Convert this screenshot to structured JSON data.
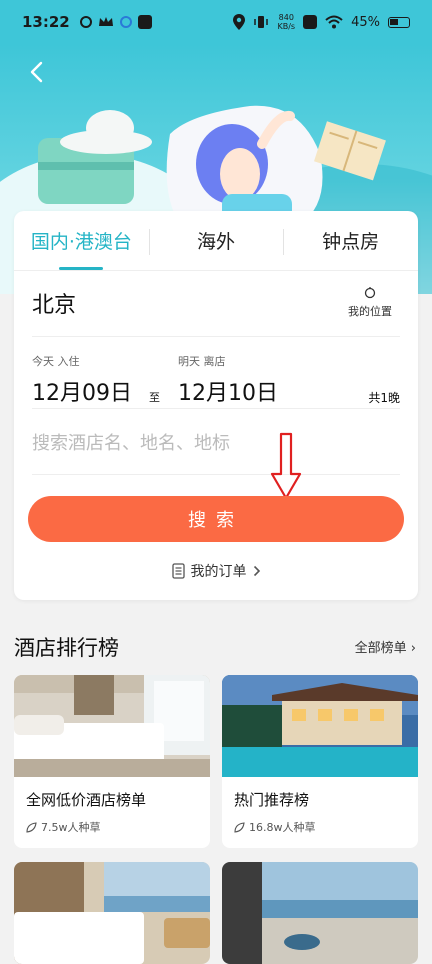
{
  "status_bar": {
    "time": "13:22",
    "net_speed_value": "840",
    "net_speed_unit": "KB/s",
    "battery": "45%"
  },
  "tabs": [
    {
      "label": "国内·港澳台",
      "active": true
    },
    {
      "label": "海外",
      "active": false
    },
    {
      "label": "钟点房",
      "active": false
    }
  ],
  "search_form": {
    "city": "北京",
    "my_location": "我的位置",
    "checkin_label": "今天  入住",
    "checkin_date": "12月09日",
    "separator": "至",
    "checkout_label": "明天  离店",
    "checkout_date": "12月10日",
    "nights": "共1晚",
    "keyword_placeholder": "搜索酒店名、地名、地标",
    "search_button": "搜索",
    "my_orders": "我的订单"
  },
  "ranking": {
    "title": "酒店排行榜",
    "all_lists": "全部榜单",
    "items": [
      {
        "name": "全网低价酒店榜单",
        "meta": "7.5w人种草"
      },
      {
        "name": "热门推荐榜",
        "meta": "16.8w人种草"
      }
    ]
  },
  "colors": {
    "accent": "#25b4c6",
    "search_button": "#fb6a44",
    "hero": "#3ec6d8"
  }
}
